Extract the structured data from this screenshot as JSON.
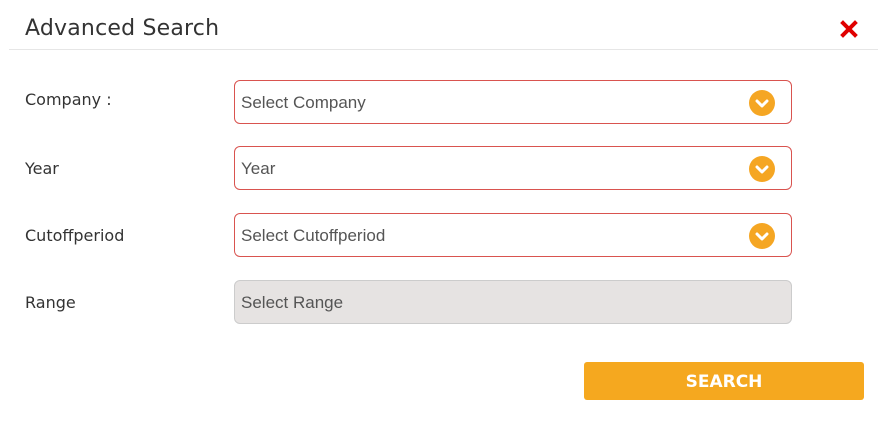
{
  "dialog": {
    "title": "Advanced Search",
    "close_icon": "close-icon"
  },
  "fields": [
    {
      "label": "Company :",
      "placeholder": "Select Company",
      "disabled": false
    },
    {
      "label": "Year",
      "placeholder": "Year",
      "disabled": false
    },
    {
      "label": "Cutoffperiod",
      "placeholder": "Select Cutoffperiod",
      "disabled": false
    },
    {
      "label": "Range",
      "placeholder": "Select Range",
      "disabled": true
    }
  ],
  "search_button": {
    "label": "SEARCH"
  },
  "colors": {
    "accent": "#f5a623",
    "field_border": "#d9534f",
    "close": "#e00000",
    "disabled_bg": "#e6e3e2"
  }
}
